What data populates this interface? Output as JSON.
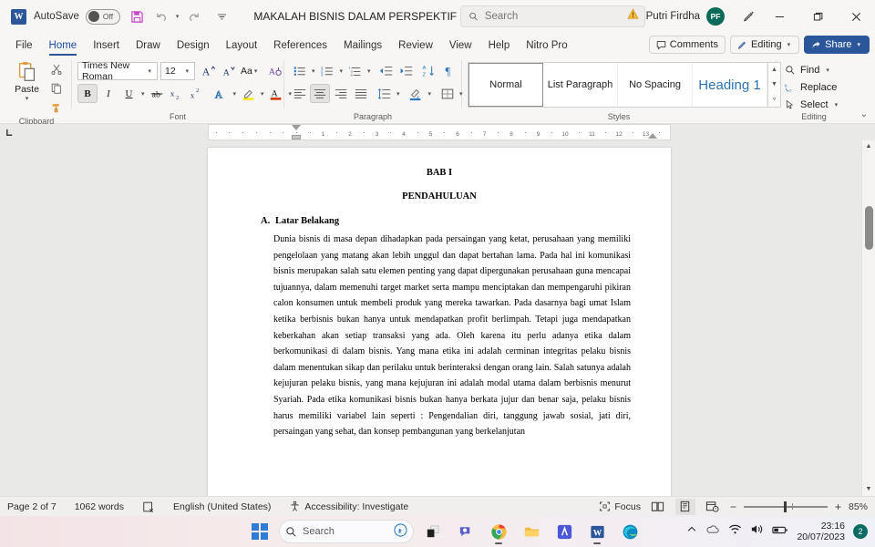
{
  "titlebar": {
    "app_icon": "word-icon",
    "autosave_label": "AutoSave",
    "autosave_state": "Off",
    "save_icon": "save-icon",
    "undo_icon": "undo-icon",
    "redo_icon": "redo-icon",
    "customize_icon": "customize-quick-access-icon",
    "document_title": "MAKALAH BISNIS DALAM PERSPEKTIF ISLAM • Saved",
    "title_chevron": "chevron-down-icon",
    "search_placeholder": "Search",
    "search_value": "",
    "search_icon": "search-icon",
    "warning_icon": "warning-icon",
    "user_name": "Putri Firdha",
    "user_initials": "PF",
    "pen_icon": "edit-pen-icon",
    "minimize": "minimize-icon",
    "restore": "restore-icon",
    "close": "close-icon"
  },
  "tabs": [
    {
      "label": "File",
      "active": false
    },
    {
      "label": "Home",
      "active": true
    },
    {
      "label": "Insert",
      "active": false
    },
    {
      "label": "Draw",
      "active": false
    },
    {
      "label": "Design",
      "active": false
    },
    {
      "label": "Layout",
      "active": false
    },
    {
      "label": "References",
      "active": false
    },
    {
      "label": "Mailings",
      "active": false
    },
    {
      "label": "Review",
      "active": false
    },
    {
      "label": "View",
      "active": false
    },
    {
      "label": "Help",
      "active": false
    },
    {
      "label": "Nitro Pro",
      "active": false
    }
  ],
  "tab_actions": {
    "comments": "Comments",
    "editing": "Editing",
    "share": "Share"
  },
  "ribbon": {
    "clipboard": {
      "label": "Clipboard",
      "paste": "Paste",
      "cut_icon": "scissors-icon",
      "copy_icon": "copy-icon",
      "format_painter_icon": "format-painter-icon"
    },
    "font": {
      "label": "Font",
      "font_family": "Times New Roman",
      "font_size": "12",
      "grow_icon": "increase-font-size-icon",
      "shrink_icon": "decrease-font-size-icon",
      "change_case": "Aa",
      "clear_formatting_icon": "clear-formatting-icon",
      "bold": "B",
      "italic": "I",
      "underline": "U",
      "strikethrough_icon": "strikethrough-icon",
      "subscript_icon": "subscript-icon",
      "superscript_icon": "superscript-icon",
      "text_effects_icon": "text-effects-icon",
      "highlight_icon": "text-highlight-icon",
      "font_color_icon": "font-color-icon"
    },
    "paragraph": {
      "label": "Paragraph",
      "bullets_icon": "bullet-list-icon",
      "numbering_icon": "numbered-list-icon",
      "multilevel_icon": "multilevel-list-icon",
      "decrease_indent_icon": "decrease-indent-icon",
      "increase_indent_icon": "increase-indent-icon",
      "sort_icon": "sort-icon",
      "show_marks_icon": "paragraph-marks-icon",
      "align_left_icon": "align-left-icon",
      "align_center_icon": "align-center-icon",
      "align_right_icon": "align-right-icon",
      "justify_icon": "justify-icon",
      "line_spacing_icon": "line-spacing-icon",
      "shading_icon": "shading-icon",
      "borders_icon": "borders-icon"
    },
    "styles": {
      "label": "Styles",
      "items": [
        {
          "name": "Normal",
          "selected": true
        },
        {
          "name": "List Paragraph",
          "selected": false
        },
        {
          "name": "No Spacing",
          "selected": false
        },
        {
          "name": "Heading 1",
          "selected": false
        }
      ]
    },
    "editing": {
      "label": "Editing",
      "find": "Find",
      "replace": "Replace",
      "select": "Select",
      "find_icon": "search-icon",
      "replace_icon": "replace-icon",
      "select_icon": "cursor-select-icon"
    },
    "collapse_icon": "collapse-ribbon-icon"
  },
  "ruler": {
    "ticks": [
      "1",
      "2",
      "3",
      "4",
      "5",
      "6",
      "7",
      "8",
      "9",
      "10",
      "11",
      "12",
      "13"
    ]
  },
  "document": {
    "chapter": "BAB I",
    "chapter_title": "PENDAHULUAN",
    "section_mark": "A.",
    "section_title": "Latar Belakang",
    "paragraph": "Dunia bisnis di masa depan dihadapkan pada persaingan yang ketat, perusahaan yang memiliki pengelolaan yang matang akan lebih unggul dan dapat bertahan lama. Pada hal ini komunikasi bisnis merupakan salah satu elemen penting yang dapat dipergunakan perusahaan guna mencapai tujuannya, dalam memenuhi target market serta mampu menciptakan dan mempengaruhi pikiran calon konsumen untuk membeli produk yang mereka tawarkan. Pada dasarnya bagi umat Islam ketika berbisnis bukan hanya untuk mendapatkan profit berlimpah. Tetapi juga mendapatkan keberkahan akan setiap transaksi yang ada. Oleh karena itu perlu adanya etika dalam berkomunikasi di dalam bisnis. Yang mana etika ini adalah cerminan integritas pelaku bisnis dalam menentukan sikap dan perilaku untuk berinteraksi dengan orang lain. Salah satunya adalah kejujuran pelaku bisnis, yang mana kejujuran ini adalah modal utama dalam berbisnis menurut Syariah. Pada etika komunikasi bisnis bukan hanya berkata jujur dan benar saja, pelaku bisnis harus memiliki variabel lain seperti : Pengendalian diri, tanggung jawab sosial, jati diri, persaingan yang sehat, dan konsep pembangunan yang berkelanjutan"
  },
  "statusbar": {
    "page": "Page 2 of 7",
    "words": "1062 words",
    "proofing_icon": "proofing-errors-icon",
    "language": "English (United States)",
    "accessibility_icon": "accessibility-icon",
    "accessibility": "Accessibility: Investigate",
    "focus_icon": "focus-mode-icon",
    "focus": "Focus",
    "read_mode_icon": "read-mode-icon",
    "print_layout_icon": "print-layout-icon",
    "web_layout_icon": "web-layout-icon",
    "zoom_out": "−",
    "zoom_in": "+",
    "zoom_level": "85%"
  },
  "taskbar": {
    "start_icon": "windows-start-icon",
    "search_placeholder": "Search",
    "bing_icon": "bing-chat-icon",
    "apps": [
      {
        "name": "task-view-icon"
      },
      {
        "name": "teams-icon"
      },
      {
        "name": "chrome-icon"
      },
      {
        "name": "file-explorer-icon"
      },
      {
        "name": "mendeley-icon"
      },
      {
        "name": "word-icon"
      },
      {
        "name": "edge-icon"
      }
    ],
    "tray": {
      "chevron_icon": "show-hidden-icons-icon",
      "onedrive_icon": "onedrive-icon",
      "wifi_icon": "wifi-icon",
      "volume_icon": "volume-icon",
      "battery_icon": "battery-icon",
      "time": "23:16",
      "date": "20/07/2023",
      "notification_count": "2"
    }
  },
  "colors": {
    "accent": "#2b579a",
    "heading1": "#2e74b5",
    "avatar": "#0b6a58",
    "save_icon": "#c646c6"
  }
}
